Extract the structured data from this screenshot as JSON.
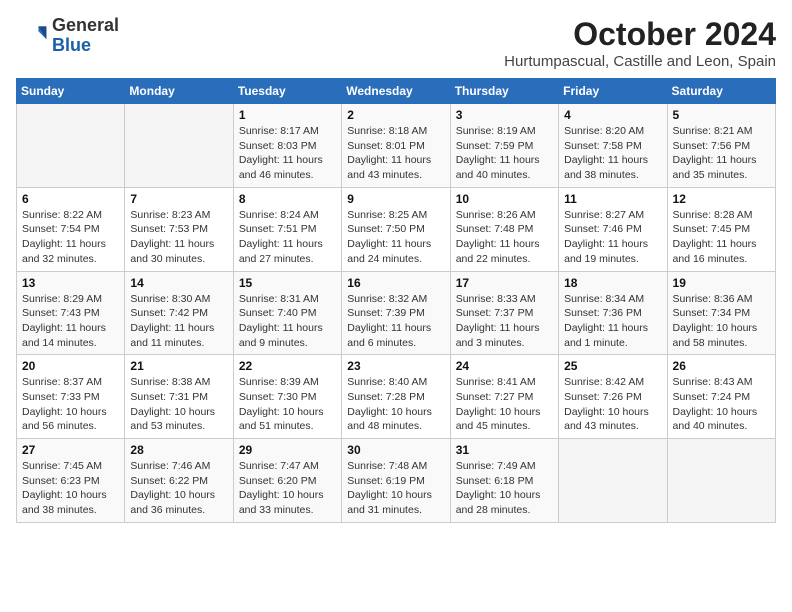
{
  "header": {
    "logo_general": "General",
    "logo_blue": "Blue",
    "title": "October 2024",
    "subtitle": "Hurtumpascual, Castille and Leon, Spain"
  },
  "weekdays": [
    "Sunday",
    "Monday",
    "Tuesday",
    "Wednesday",
    "Thursday",
    "Friday",
    "Saturday"
  ],
  "weeks": [
    [
      {
        "day": "",
        "detail": ""
      },
      {
        "day": "",
        "detail": ""
      },
      {
        "day": "1",
        "detail": "Sunrise: 8:17 AM\nSunset: 8:03 PM\nDaylight: 11 hours and 46 minutes."
      },
      {
        "day": "2",
        "detail": "Sunrise: 8:18 AM\nSunset: 8:01 PM\nDaylight: 11 hours and 43 minutes."
      },
      {
        "day": "3",
        "detail": "Sunrise: 8:19 AM\nSunset: 7:59 PM\nDaylight: 11 hours and 40 minutes."
      },
      {
        "day": "4",
        "detail": "Sunrise: 8:20 AM\nSunset: 7:58 PM\nDaylight: 11 hours and 38 minutes."
      },
      {
        "day": "5",
        "detail": "Sunrise: 8:21 AM\nSunset: 7:56 PM\nDaylight: 11 hours and 35 minutes."
      }
    ],
    [
      {
        "day": "6",
        "detail": "Sunrise: 8:22 AM\nSunset: 7:54 PM\nDaylight: 11 hours and 32 minutes."
      },
      {
        "day": "7",
        "detail": "Sunrise: 8:23 AM\nSunset: 7:53 PM\nDaylight: 11 hours and 30 minutes."
      },
      {
        "day": "8",
        "detail": "Sunrise: 8:24 AM\nSunset: 7:51 PM\nDaylight: 11 hours and 27 minutes."
      },
      {
        "day": "9",
        "detail": "Sunrise: 8:25 AM\nSunset: 7:50 PM\nDaylight: 11 hours and 24 minutes."
      },
      {
        "day": "10",
        "detail": "Sunrise: 8:26 AM\nSunset: 7:48 PM\nDaylight: 11 hours and 22 minutes."
      },
      {
        "day": "11",
        "detail": "Sunrise: 8:27 AM\nSunset: 7:46 PM\nDaylight: 11 hours and 19 minutes."
      },
      {
        "day": "12",
        "detail": "Sunrise: 8:28 AM\nSunset: 7:45 PM\nDaylight: 11 hours and 16 minutes."
      }
    ],
    [
      {
        "day": "13",
        "detail": "Sunrise: 8:29 AM\nSunset: 7:43 PM\nDaylight: 11 hours and 14 minutes."
      },
      {
        "day": "14",
        "detail": "Sunrise: 8:30 AM\nSunset: 7:42 PM\nDaylight: 11 hours and 11 minutes."
      },
      {
        "day": "15",
        "detail": "Sunrise: 8:31 AM\nSunset: 7:40 PM\nDaylight: 11 hours and 9 minutes."
      },
      {
        "day": "16",
        "detail": "Sunrise: 8:32 AM\nSunset: 7:39 PM\nDaylight: 11 hours and 6 minutes."
      },
      {
        "day": "17",
        "detail": "Sunrise: 8:33 AM\nSunset: 7:37 PM\nDaylight: 11 hours and 3 minutes."
      },
      {
        "day": "18",
        "detail": "Sunrise: 8:34 AM\nSunset: 7:36 PM\nDaylight: 11 hours and 1 minute."
      },
      {
        "day": "19",
        "detail": "Sunrise: 8:36 AM\nSunset: 7:34 PM\nDaylight: 10 hours and 58 minutes."
      }
    ],
    [
      {
        "day": "20",
        "detail": "Sunrise: 8:37 AM\nSunset: 7:33 PM\nDaylight: 10 hours and 56 minutes."
      },
      {
        "day": "21",
        "detail": "Sunrise: 8:38 AM\nSunset: 7:31 PM\nDaylight: 10 hours and 53 minutes."
      },
      {
        "day": "22",
        "detail": "Sunrise: 8:39 AM\nSunset: 7:30 PM\nDaylight: 10 hours and 51 minutes."
      },
      {
        "day": "23",
        "detail": "Sunrise: 8:40 AM\nSunset: 7:28 PM\nDaylight: 10 hours and 48 minutes."
      },
      {
        "day": "24",
        "detail": "Sunrise: 8:41 AM\nSunset: 7:27 PM\nDaylight: 10 hours and 45 minutes."
      },
      {
        "day": "25",
        "detail": "Sunrise: 8:42 AM\nSunset: 7:26 PM\nDaylight: 10 hours and 43 minutes."
      },
      {
        "day": "26",
        "detail": "Sunrise: 8:43 AM\nSunset: 7:24 PM\nDaylight: 10 hours and 40 minutes."
      }
    ],
    [
      {
        "day": "27",
        "detail": "Sunrise: 7:45 AM\nSunset: 6:23 PM\nDaylight: 10 hours and 38 minutes."
      },
      {
        "day": "28",
        "detail": "Sunrise: 7:46 AM\nSunset: 6:22 PM\nDaylight: 10 hours and 36 minutes."
      },
      {
        "day": "29",
        "detail": "Sunrise: 7:47 AM\nSunset: 6:20 PM\nDaylight: 10 hours and 33 minutes."
      },
      {
        "day": "30",
        "detail": "Sunrise: 7:48 AM\nSunset: 6:19 PM\nDaylight: 10 hours and 31 minutes."
      },
      {
        "day": "31",
        "detail": "Sunrise: 7:49 AM\nSunset: 6:18 PM\nDaylight: 10 hours and 28 minutes."
      },
      {
        "day": "",
        "detail": ""
      },
      {
        "day": "",
        "detail": ""
      }
    ]
  ]
}
